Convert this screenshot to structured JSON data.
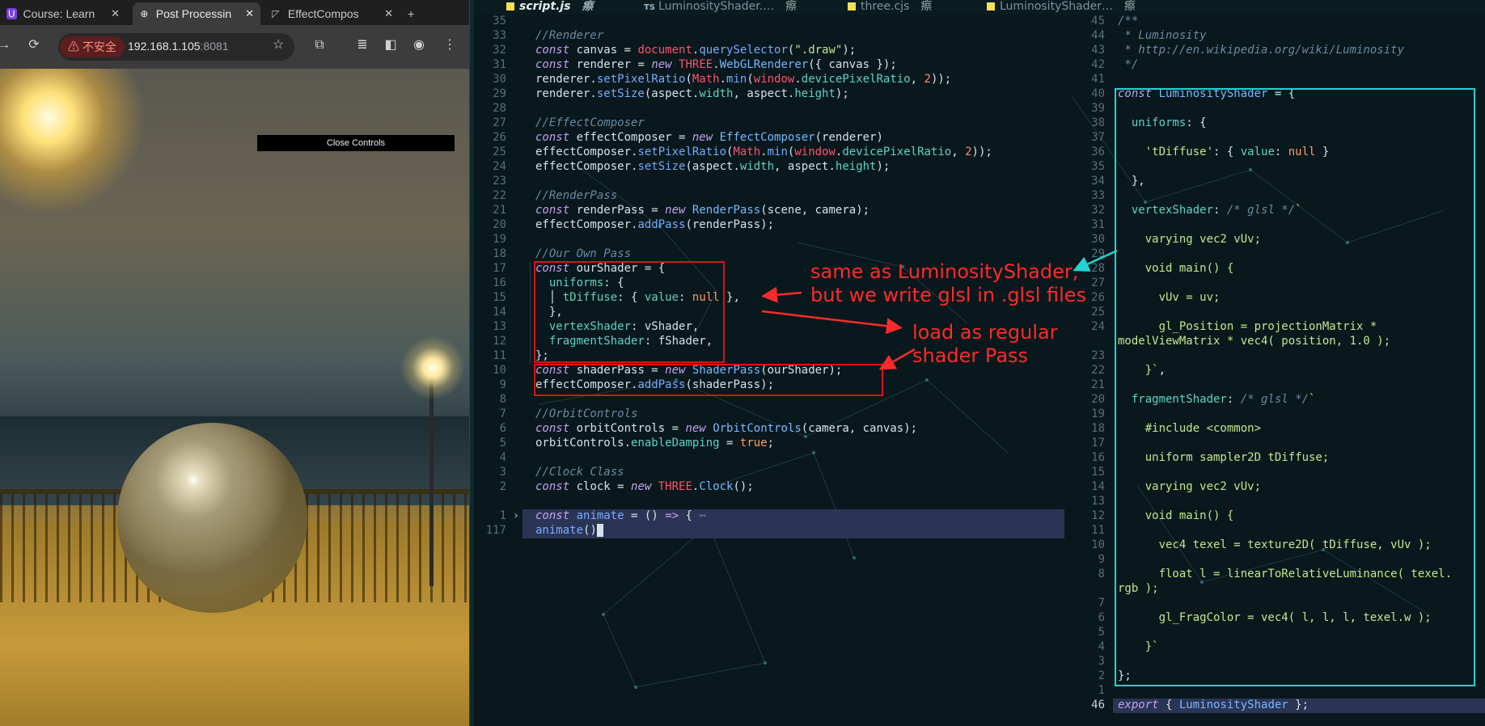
{
  "browser": {
    "tabs": [
      {
        "title": "Course: Learn",
        "icon": "course-favicon"
      },
      {
        "title": "Post Processin",
        "icon": "globe-icon"
      },
      {
        "title": "EffectCompos",
        "icon": "threejs-favicon"
      }
    ],
    "new_tab": "+",
    "security_label": "⚠ 不安全",
    "url_host": "192.168.1.105",
    "url_port": ":8081",
    "close_controls": "Close Controls"
  },
  "editor": {
    "tabs": [
      {
        "name": "script.js",
        "kind": "js"
      },
      {
        "name": "LuminosityShader.…",
        "kind": "ts"
      },
      {
        "name": "three.cjs",
        "kind": "js"
      },
      {
        "name": "LuminosityShader…",
        "kind": "js"
      }
    ],
    "close_glyph": "瘵",
    "left_gutter": [
      "35",
      "",
      "33",
      "32",
      "31",
      "30",
      "29",
      "28",
      "27",
      "26",
      "25",
      "24",
      "23",
      "22",
      "21",
      "20",
      "19",
      "18",
      "17",
      "16",
      "15",
      "14",
      "13",
      "12",
      "11",
      "10",
      "9",
      "8",
      "7",
      "6",
      "5",
      "4",
      "3",
      "2",
      "1",
      "117"
    ],
    "right_gutter": [
      "45",
      "44",
      "43",
      "42",
      "41",
      "40",
      "39",
      "38",
      "37",
      "36",
      "35",
      "34",
      "33",
      "32",
      "31",
      "30",
      "29",
      "28",
      "27",
      "26",
      "25",
      "24",
      "",
      "23",
      "22",
      "21",
      "20",
      "19",
      "18",
      "17",
      "16",
      "15",
      "14",
      "13",
      "12",
      "11",
      "10",
      "9",
      "8",
      "",
      "7",
      "6",
      "5",
      "4",
      "3",
      "2",
      "1",
      "46"
    ]
  },
  "annotations": {
    "note1_line1": "same as LuminosityShader,",
    "note1_line2": "but we write glsl in .glsl files",
    "note2_line1": "load as regular",
    "note2_line2": "shader Pass"
  }
}
